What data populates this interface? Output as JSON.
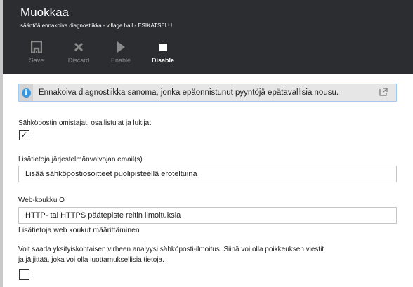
{
  "header": {
    "title": "Muokkaa",
    "subtitle": "sääntöä ennakoiva diagnostiikka - village hall - ESIKATSELU"
  },
  "toolbar": {
    "save": "Save",
    "discard": "Discard",
    "enable": "Enable",
    "disable": "Disable"
  },
  "info": {
    "text": "Ennakoiva diagnostiikka sanoma, jonka epäonnistunut pyyntöjä epätavallisia nousu."
  },
  "form": {
    "email_owners_label": "Sähköpostin omistajat, osallistujat ja lukijat",
    "email_owners_checked": true,
    "admin_email_label": "Lisätietoja järjestelmänvalvojan email(s)",
    "admin_email_placeholder": "Lisää sähköpostiosoitteet puolipisteellä eroteltuina",
    "webhook_label": "Web-koukku O",
    "webhook_placeholder": "HTTP- tai HTTPS päätepiste reitin ilmoituksia",
    "webhook_link": "Lisätietoja web koukut määrittäminen",
    "detail_text_1": "Voit saada yksityiskohtaisen virheen analyysi sähköposti-ilmoitus. Siinä voi olla poikkeuksen viestit",
    "detail_text_2": "ja jäljittää, joka voi olla luottamuksellisia tietoja.",
    "detail_checked": false
  }
}
